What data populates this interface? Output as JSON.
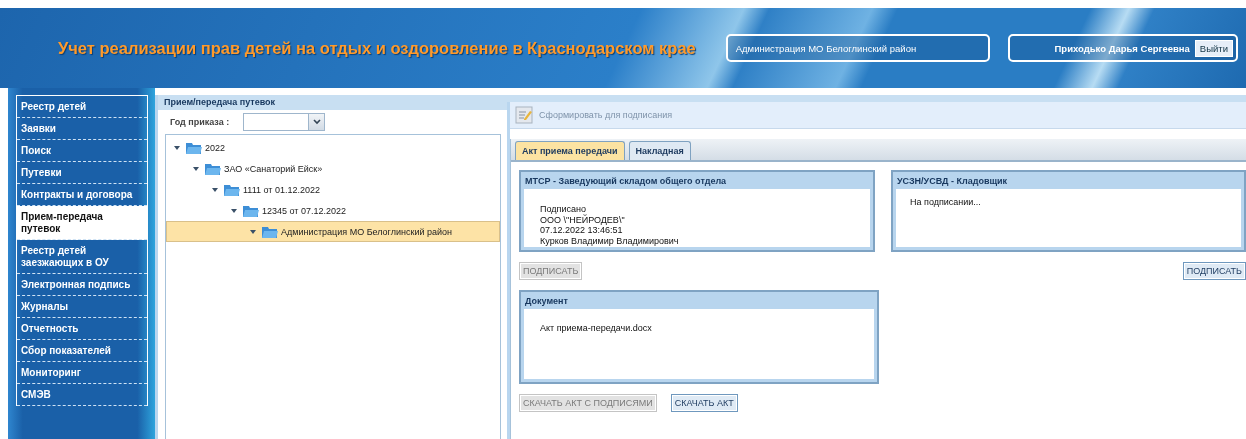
{
  "header": {
    "title": "Учет реализации прав детей на отдых и оздоровление в Краснодарском крае",
    "organization": "Администрация МО Белоглинский район",
    "user": "Приходько Дарья Сергеевна",
    "logout": "Выйти"
  },
  "sidebar": {
    "items": [
      {
        "label": "Реестр детей",
        "selected": false
      },
      {
        "label": "Заявки",
        "selected": false
      },
      {
        "label": "Поиск",
        "selected": false
      },
      {
        "label": "Путевки",
        "selected": false
      },
      {
        "label": "Контракты и договора",
        "selected": false
      },
      {
        "label": "Прием-передача путевок",
        "selected": true
      },
      {
        "label": "Реестр детей заезжающих в ОУ",
        "selected": false
      },
      {
        "label": "Электронная подпись",
        "selected": false
      },
      {
        "label": "Журналы",
        "selected": false
      },
      {
        "label": "Отчетность",
        "selected": false
      },
      {
        "label": "Сбор показателей",
        "selected": false
      },
      {
        "label": "Мониторинг",
        "selected": false
      },
      {
        "label": "СМЭВ",
        "selected": false
      }
    ]
  },
  "panel_title": "Прием/передача путевок",
  "filter": {
    "label": "Год приказа :"
  },
  "tree": [
    {
      "label": "2022",
      "expanded": true,
      "selected": false,
      "children": [
        {
          "label": "ЗАО «Санаторий Ейск»",
          "expanded": true,
          "selected": false,
          "children": [
            {
              "label": "1111 от 01.12.2022",
              "expanded": true,
              "selected": false,
              "children": [
                {
                  "label": "12345 от 07.12.2022",
                  "expanded": true,
                  "selected": false,
                  "children": [
                    {
                      "label": "Администрация МО Белоглинский район",
                      "expanded": true,
                      "selected": true
                    }
                  ]
                }
              ]
            }
          ]
        }
      ]
    }
  ],
  "toolbar": {
    "label": "Сформировать для подписания",
    "disabled": true
  },
  "tabs": [
    {
      "label": "Акт приема передачи",
      "selected": true
    },
    {
      "label": "Накладная",
      "selected": false
    }
  ],
  "signers": [
    {
      "title": "МТСР - Заведующий складом общего отдела",
      "lines": [
        "Подписано",
        "ООО \\\"НЕЙРОДЕВ\\\"",
        "07.12.2022 13:46:51",
        "Курков Владимир Владимирович"
      ],
      "button": {
        "label": "ПОДПИСАТЬ",
        "disabled": true
      }
    },
    {
      "title": "УСЗН/УСВД - Кладовщик",
      "lines": [
        "На подписании..."
      ],
      "button": {
        "label": "ПОДПИСАТЬ",
        "disabled": false
      }
    }
  ],
  "document": {
    "title": "Документ",
    "file": "Акт приема-передачи.docx"
  },
  "buttons": [
    {
      "label": "СКАЧАТЬ АКТ С ПОДПИСЯМИ",
      "disabled": true
    },
    {
      "label": "СКАЧАТЬ АКТ",
      "disabled": false
    }
  ]
}
